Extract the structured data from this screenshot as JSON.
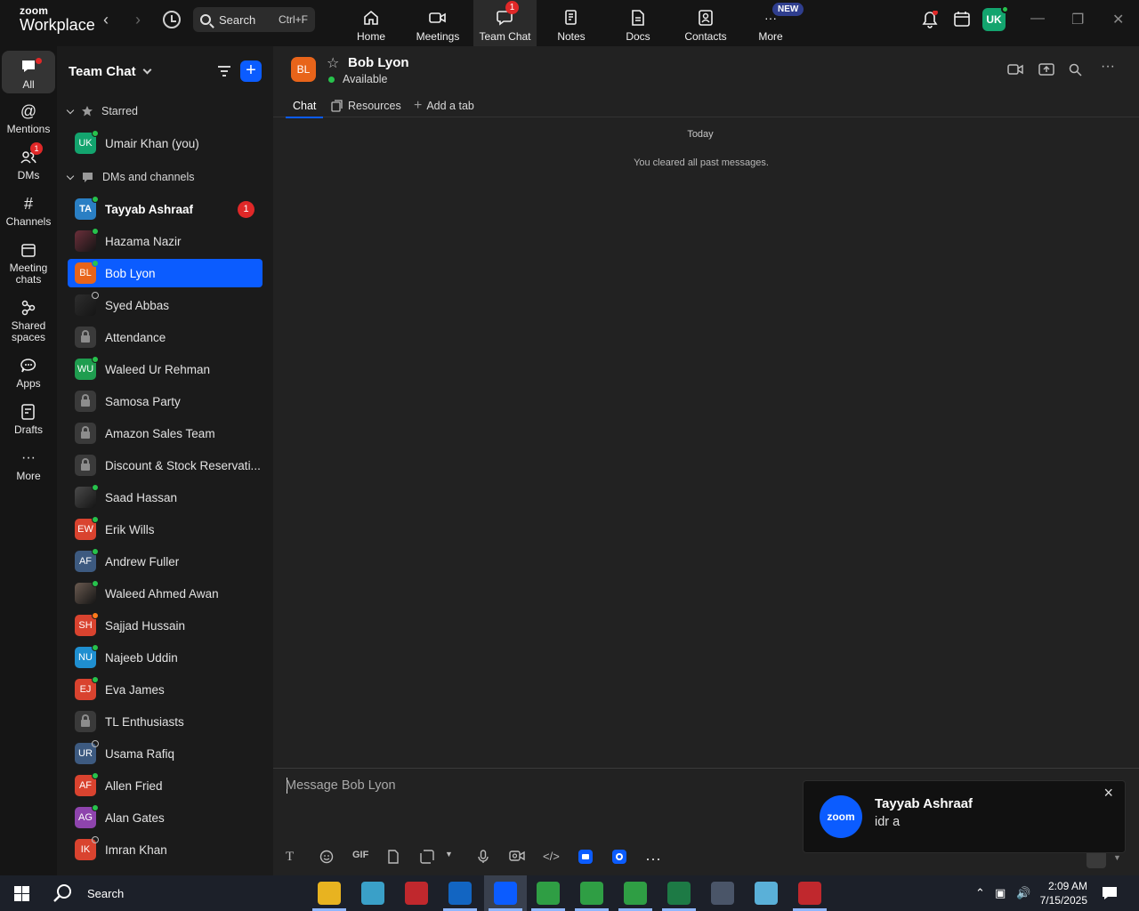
{
  "app": {
    "logo_top": "zoom",
    "logo_bottom": "Workplace"
  },
  "topbar": {
    "search_label": "Search",
    "search_shortcut": "Ctrl+F",
    "tabs": [
      {
        "label": "Home",
        "icon": "home-icon"
      },
      {
        "label": "Meetings",
        "icon": "video-camera-icon"
      },
      {
        "label": "Team Chat",
        "icon": "chat-bubble-icon",
        "badge": "1",
        "active": true
      },
      {
        "label": "Notes",
        "icon": "notes-icon"
      },
      {
        "label": "Docs",
        "icon": "document-icon"
      },
      {
        "label": "Contacts",
        "icon": "contacts-icon"
      },
      {
        "label": "More",
        "icon": "more-dots-icon",
        "badge": "NEW"
      }
    ],
    "user_initials": "UK"
  },
  "rail": {
    "items": [
      {
        "label": "All",
        "active": true
      },
      {
        "label": "Mentions"
      },
      {
        "label": "DMs",
        "badge": "1"
      },
      {
        "label": "Channels"
      },
      {
        "label": "Meeting chats"
      },
      {
        "label": "Shared spaces"
      },
      {
        "label": "Apps"
      },
      {
        "label": "Drafts"
      },
      {
        "label": "More"
      }
    ]
  },
  "sidebar": {
    "title": "Team Chat",
    "starred_label": "Starred",
    "dms_label": "DMs and channels",
    "starred": [
      {
        "initials": "UK",
        "name": "Umair Khan (you)",
        "color": "#13a46e",
        "status": "on"
      }
    ],
    "items": [
      {
        "initials": "TA",
        "name": "Tayyab Ashraaf",
        "color": "#2a7fc4",
        "status": "on",
        "unread": "1",
        "bold": true
      },
      {
        "initials": "",
        "name": "Hazama Nazir",
        "color": "#6b2f3a",
        "status": "on"
      },
      {
        "initials": "BL",
        "name": "Bob Lyon",
        "color": "#e8641a",
        "status": "on",
        "selected": true
      },
      {
        "initials": "",
        "name": "Syed Abbas",
        "color": "#2e2e2e",
        "status": "off"
      },
      {
        "initials": "",
        "name": "Attendance",
        "lock": true
      },
      {
        "initials": "WU",
        "name": "Waleed Ur Rehman",
        "color": "#1f9d4f",
        "status": "on"
      },
      {
        "initials": "",
        "name": "Samosa Party",
        "lock": true
      },
      {
        "initials": "",
        "name": "Amazon Sales Team",
        "lock": true
      },
      {
        "initials": "",
        "name": "Discount & Stock Reservati...",
        "lock": true
      },
      {
        "initials": "",
        "name": "Saad Hassan",
        "color": "#4a4a4a",
        "status": "on"
      },
      {
        "initials": "EW",
        "name": "Erik Wills",
        "color": "#d9432f",
        "status": "on"
      },
      {
        "initials": "AF",
        "name": "Andrew Fuller",
        "color": "#3d5a80",
        "status": "on"
      },
      {
        "initials": "",
        "name": "Waleed Ahmed Awan",
        "color": "#6a5a50",
        "status": "on"
      },
      {
        "initials": "SH",
        "name": "Sajjad Hussain",
        "color": "#d9432f",
        "status": "busy"
      },
      {
        "initials": "NU",
        "name": "Najeeb Uddin",
        "color": "#1f8fd0",
        "status": "on"
      },
      {
        "initials": "EJ",
        "name": "Eva James",
        "color": "#d9432f",
        "status": "on"
      },
      {
        "initials": "",
        "name": "TL Enthusiasts",
        "lock": true
      },
      {
        "initials": "UR",
        "name": "Usama Rafiq",
        "color": "#3d5a80",
        "status": "off"
      },
      {
        "initials": "AF",
        "name": "Allen Fried",
        "color": "#d9432f",
        "status": "on"
      },
      {
        "initials": "AG",
        "name": "Alan Gates",
        "color": "#8e44ad",
        "status": "on"
      },
      {
        "initials": "IK",
        "name": "Imran Khan",
        "color": "#d9432f",
        "status": "off"
      }
    ]
  },
  "chat": {
    "initials": "BL",
    "name": "Bob Lyon",
    "status": "Available",
    "tabs": [
      "Chat",
      "Resources",
      "Add a tab"
    ],
    "date_divider": "Today",
    "system_message": "You cleared all past messages.",
    "composer_placeholder": "Message Bob Lyon",
    "gif_label": "GIF"
  },
  "toast": {
    "logo": "zoom",
    "name": "Tayyab Ashraaf",
    "message": "idr a"
  },
  "taskbar": {
    "search_label": "Search",
    "time": "2:09 AM",
    "date": "7/15/2025",
    "apps": [
      {
        "icon": "file-explorer-icon",
        "color": "#e8b320"
      },
      {
        "icon": "app-diamond-icon",
        "color": "#3aa0c8"
      },
      {
        "icon": "filezilla-icon",
        "color": "#c0282d"
      },
      {
        "icon": "outlook-icon",
        "color": "#1265c2"
      },
      {
        "icon": "zoom-icon",
        "color": "#0b5cff"
      },
      {
        "icon": "chrome-icon",
        "color": "#2f9e44"
      },
      {
        "icon": "chrome-icon",
        "color": "#2f9e44"
      },
      {
        "icon": "chrome-icon",
        "color": "#2f9e44"
      },
      {
        "icon": "excel-icon",
        "color": "#1d7a45"
      },
      {
        "icon": "calculator-icon",
        "color": "#4a5568"
      },
      {
        "icon": "notepad-icon",
        "color": "#5ab0d8"
      },
      {
        "icon": "snipping-tool-icon",
        "color": "#c0282d"
      }
    ]
  },
  "colors": {
    "accent": "#0b5cff",
    "badge": "#e02828",
    "online": "#27c24c"
  }
}
